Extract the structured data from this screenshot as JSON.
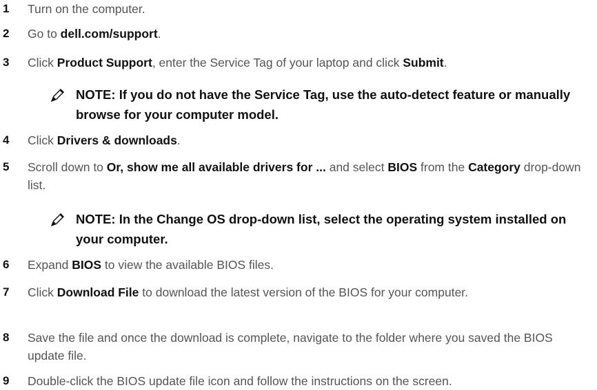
{
  "steps": [
    {
      "num": "1",
      "parts": [
        "Turn on the computer."
      ]
    },
    {
      "num": "2",
      "parts": [
        "Go to ",
        "dell.com/support",
        "."
      ]
    },
    {
      "num": "3",
      "parts": [
        "Click ",
        "Product Support",
        ", enter the Service Tag of your laptop and click ",
        "Submit",
        "."
      ]
    },
    {
      "num": "4",
      "parts": [
        "Click ",
        "Drivers & downloads",
        "."
      ]
    },
    {
      "num": "5",
      "parts": [
        "Scroll down to ",
        "Or, show me all available drivers for ...",
        " and select ",
        "BIOS",
        " from the ",
        "Category",
        " drop-down list."
      ]
    },
    {
      "num": "6",
      "parts": [
        "Expand ",
        "BIOS",
        " to view the available BIOS files."
      ]
    },
    {
      "num": "7",
      "parts": [
        "Click ",
        "Download File",
        " to download the latest version of the BIOS for your computer."
      ]
    },
    {
      "num": "8",
      "parts": [
        "Save the file and once the download is complete, navigate to the folder where you saved the BIOS update file."
      ]
    },
    {
      "num": "9",
      "parts": [
        "Double-click the BIOS update file icon and follow the instructions on the screen."
      ]
    }
  ],
  "notes": [
    {
      "text": "NOTE: If you do not have the Service Tag, use the auto-detect feature or manually browse for your computer model.",
      "icon": "note-pencil-icon"
    },
    {
      "text": "NOTE: In the Change OS drop-down list, select the operating system installed on your computer.",
      "icon": "note-pencil-icon"
    }
  ],
  "colors": {
    "body_text": "#555555",
    "bold_text": "#111111"
  }
}
